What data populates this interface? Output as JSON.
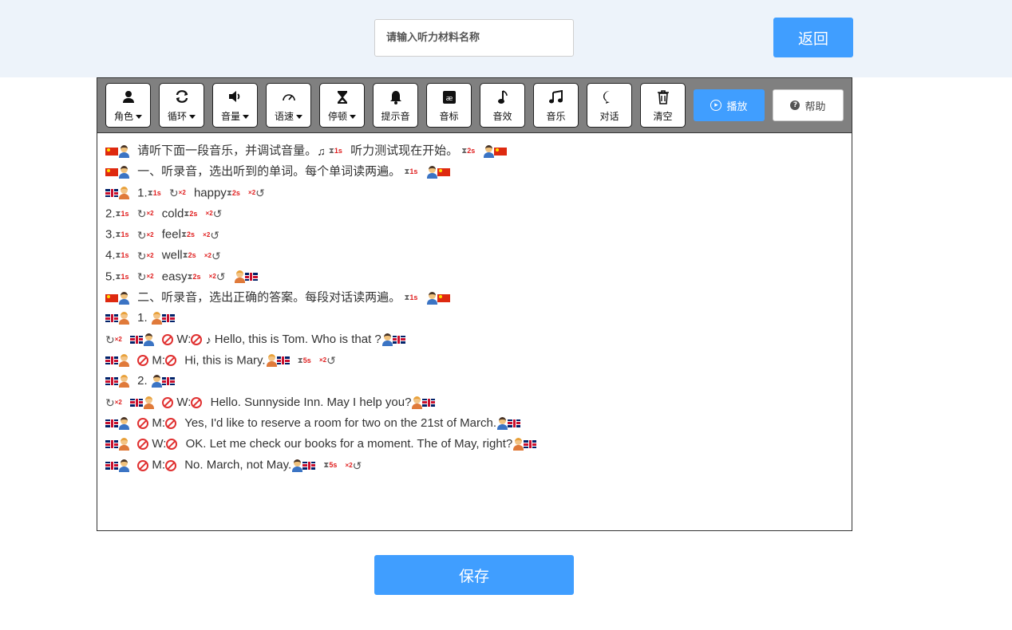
{
  "header": {
    "title_placeholder": "请输入听力材料名称",
    "back_label": "返回"
  },
  "toolbar": {
    "tools": [
      {
        "icon": "person-icon",
        "label": "角色",
        "dropdown": true
      },
      {
        "icon": "loop-icon",
        "label": "循环",
        "dropdown": true
      },
      {
        "icon": "volume-icon",
        "label": "音量",
        "dropdown": true
      },
      {
        "icon": "speedometer-icon",
        "label": "语速",
        "dropdown": true
      },
      {
        "icon": "hourglass-icon",
        "label": "停顿",
        "dropdown": true
      },
      {
        "icon": "bell-icon",
        "label": "提示音",
        "dropdown": false
      },
      {
        "icon": "phonetic-icon",
        "label": "音标",
        "dropdown": false
      },
      {
        "icon": "note-icon",
        "label": "音效",
        "dropdown": false
      },
      {
        "icon": "music-icon",
        "label": "音乐",
        "dropdown": false
      },
      {
        "icon": "chat-icon",
        "label": "对话",
        "dropdown": false
      },
      {
        "icon": "trash-icon",
        "label": "清空",
        "dropdown": false
      }
    ],
    "play_label": "播放",
    "help_label": "帮助"
  },
  "content": {
    "lines": [
      {
        "t1": "请听下面一段音乐，并调试音量。",
        "t2": "听力测试现在开始。",
        "pause1": "1s",
        "pause2": "2s"
      },
      {
        "t1": "一、听录音，选出听到的单词。每个单词读两遍。",
        "pause1": "1s"
      },
      {
        "t1": "1.",
        "pause1": "1s",
        "w": "happy",
        "pause2": "2s"
      },
      {
        "t1": "2.",
        "pause1": "1s",
        "w": "cold",
        "pause2": "2s"
      },
      {
        "t1": "3.",
        "pause1": "1s",
        "w": "feel",
        "pause2": "2s"
      },
      {
        "t1": "4.",
        "pause1": "1s",
        "w": "well",
        "pause2": "2s"
      },
      {
        "t1": "5.",
        "pause1": "1s",
        "w": "easy",
        "pause2": "2s"
      },
      {
        "t1": "二、听录音，选出正确的答案。每段对话读两遍。",
        "pause1": "1s"
      },
      {
        "t1": "1."
      },
      {
        "spk": "W:",
        "t1": "Hello, this is Tom. Who is that ?"
      },
      {
        "spk": "M:",
        "t1": "Hi, this is Mary.",
        "pause1": "5s"
      },
      {
        "t1": "2."
      },
      {
        "spk": "W:",
        "t1": "Hello. Sunnyside Inn. May I help you?"
      },
      {
        "spk": "M:",
        "t1": "Yes, I'd like to reserve a room for two on the 21st of March."
      },
      {
        "spk": "W:",
        "t1": "OK. Let me check our books for a moment. The of May, right?"
      },
      {
        "spk": "M:",
        "t1": "No. March, not May.",
        "pause1": "5s"
      }
    ],
    "repeat_badge": "×2"
  },
  "footer": {
    "save_label": "保存"
  },
  "colors": {
    "accent": "#409eff",
    "topbar": "#edf3fa",
    "toolbar": "#808080"
  }
}
